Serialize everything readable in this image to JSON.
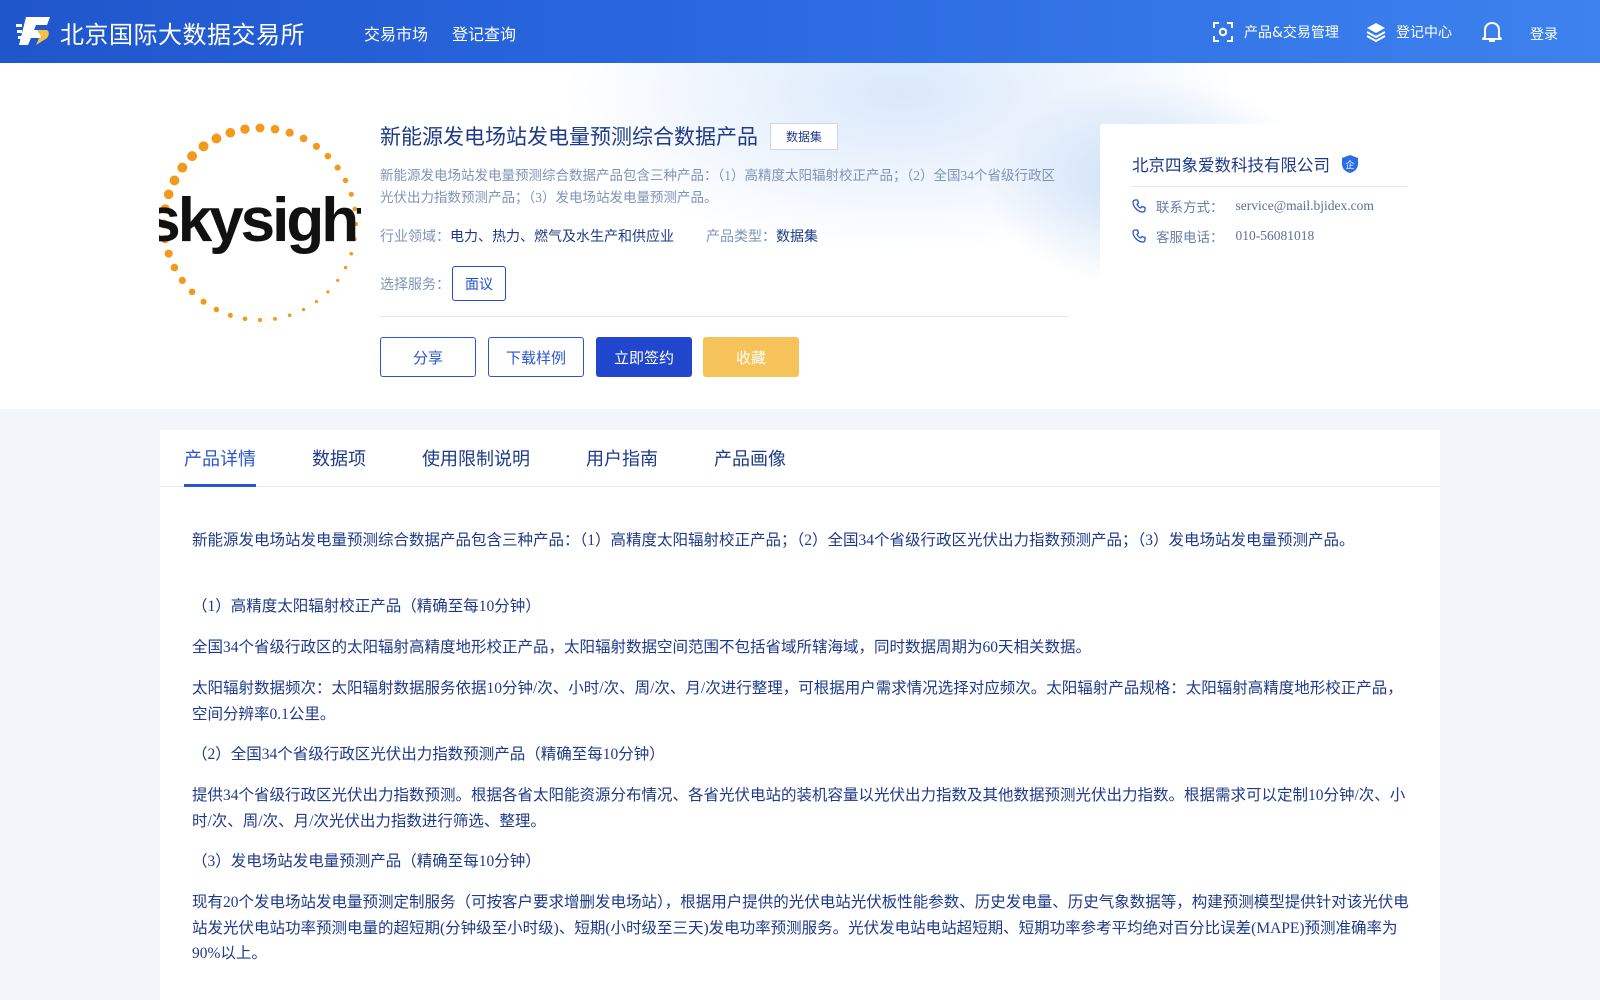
{
  "header": {
    "brand": "北京国际大数据交易所",
    "nav": [
      "交易市场",
      "登记查询"
    ],
    "product_mgmt": "产品&交易管理",
    "register_center": "登记中心",
    "login": "登录"
  },
  "product": {
    "logo_text": "skysight",
    "title": "新能源发电场站发电量预测综合数据产品",
    "tag": "数据集",
    "description": "新能源发电场站发电量预测综合数据产品包含三种产品：（1）高精度太阳辐射校正产品；（2）全国34个省级行政区光伏出力指数预测产品；（3）发电场站发电量预测产品。",
    "industry_label": "行业领域：",
    "industry_value": "电力、热力、燃气及水生产和供应业",
    "type_label": "产品类型：",
    "type_value": "数据集",
    "service_label": "选择服务：",
    "service_option": "面议",
    "actions": {
      "share": "分享",
      "download": "下载样例",
      "sign": "立即签约",
      "favorite": "收藏"
    }
  },
  "company": {
    "name": "北京四象爱数科技有限公司",
    "badge": "企",
    "contact_label": "联系方式：",
    "contact_value": "service@mail.bjidex.com",
    "phone_label": "客服电话：",
    "phone_value": "010-56081018"
  },
  "tabs": [
    "产品详情",
    "数据项",
    "使用限制说明",
    "用户指南",
    "产品画像"
  ],
  "active_tab": "产品详情",
  "details": [
    "新能源发电场站发电量预测综合数据产品包含三种产品：（1）高精度太阳辐射校正产品；（2）全国34个省级行政区光伏出力指数预测产品；（3）发电场站发电量预测产品。",
    "（1）高精度太阳辐射校正产品（精确至每10分钟）",
    "全国34个省级行政区的太阳辐射高精度地形校正产品，太阳辐射数据空间范围不包括省域所辖海域，同时数据周期为60天相关数据。",
    "太阳辐射数据频次：太阳辐射数据服务依据10分钟/次、小时/次、周/次、月/次进行整理，可根据用户需求情况选择对应频次。太阳辐射产品规格：太阳辐射高精度地形校正产品，空间分辨率0.1公里。",
    "（2）全国34个省级行政区光伏出力指数预测产品（精确至每10分钟）",
    "提供34个省级行政区光伏出力指数预测。根据各省太阳能资源分布情况、各省光伏电站的装机容量以光伏出力指数及其他数据预测光伏出力指数。根据需求可以定制10分钟/次、小时/次、周/次、月/次光伏出力指数进行筛选、整理。",
    "（3）发电场站发电量预测产品（精确至每10分钟）",
    "现有20个发电场站发电量预测定制服务（可按客户要求增删发电场站），根据用户提供的光伏电站光伏板性能参数、历史发电量、历史气象数据等，构建预测模型提供针对该光伏电站发光伏电站功率预测电量的超短期(分钟级至小时级)、短期(小时级至三天)发电功率预测服务。光伏发电站电站超短期、短期功率参考平均绝对百分比误差(MAPE)预测准确率为90%以上。"
  ]
}
